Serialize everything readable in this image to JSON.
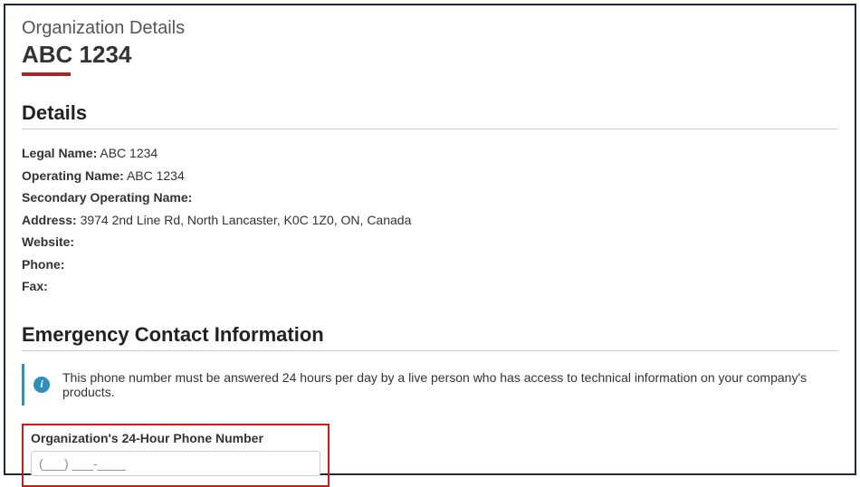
{
  "header": {
    "pretitle": "Organization Details",
    "title": "ABC 1234"
  },
  "details_section": {
    "heading": "Details",
    "legal_name_label": "Legal Name:",
    "legal_name_value": "ABC 1234",
    "operating_name_label": "Operating Name:",
    "operating_name_value": "ABC 1234",
    "secondary_operating_name_label": "Secondary Operating Name:",
    "secondary_operating_name_value": "",
    "address_label": "Address:",
    "address_value": "3974 2nd Line Rd, North Lancaster, K0C 1Z0, ON, Canada",
    "website_label": "Website:",
    "website_value": "",
    "phone_label": "Phone:",
    "phone_value": "",
    "fax_label": "Fax:",
    "fax_value": ""
  },
  "emergency_section": {
    "heading": "Emergency Contact Information",
    "info_text": "This phone number must be answered 24 hours per day by a live person who has access to technical information on your company's products.",
    "phone_field_label": "Organization's 24-Hour Phone Number",
    "phone_placeholder": "(___) ___-____",
    "phone_value": ""
  }
}
